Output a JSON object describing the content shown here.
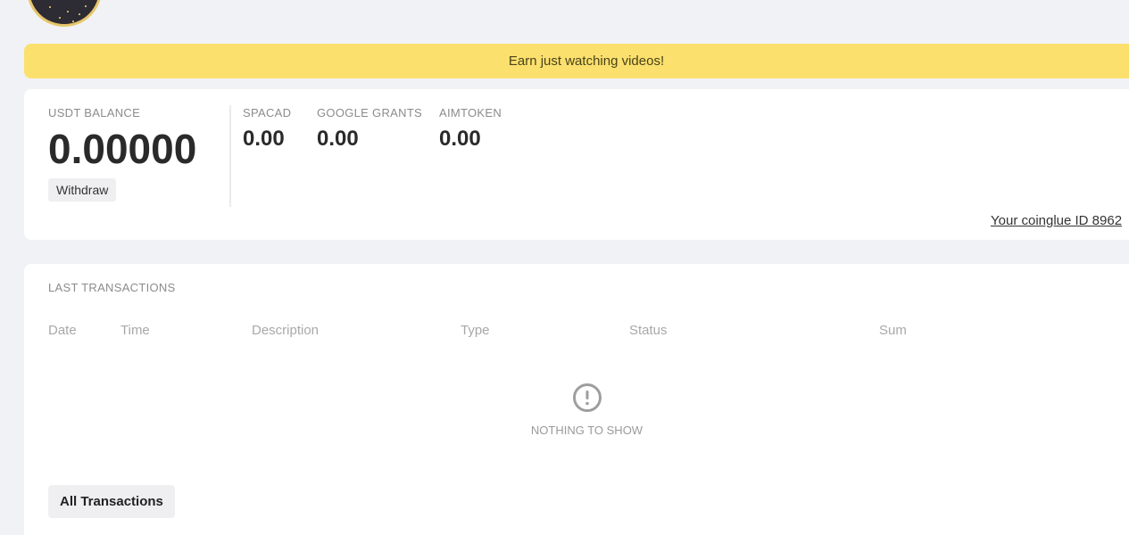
{
  "banner": {
    "text": "Earn just watching videos!",
    "color": "#fbe06e"
  },
  "balance": {
    "usdt_label": "USDT BALANCE",
    "usdt_amount": "0.00000",
    "withdraw_label": "Withdraw",
    "tokens": [
      {
        "label": "SPACAD",
        "value": "0.00"
      },
      {
        "label": "GOOGLE GRANTS",
        "value": "0.00"
      },
      {
        "label": "AIMTOKEN",
        "value": "0.00"
      }
    ],
    "coinglue_id_text": "Your coinglue ID 8962"
  },
  "transactions": {
    "title": "LAST TRANSACTIONS",
    "columns": [
      "Date",
      "Time",
      "Description",
      "Type",
      "Status",
      "Sum"
    ],
    "empty_icon": "exclamation-circle-icon",
    "empty_text": "NOTHING TO SHOW",
    "all_button_label": "All Transactions"
  },
  "user": {
    "avatar_icon": "starry-night-avatar"
  }
}
